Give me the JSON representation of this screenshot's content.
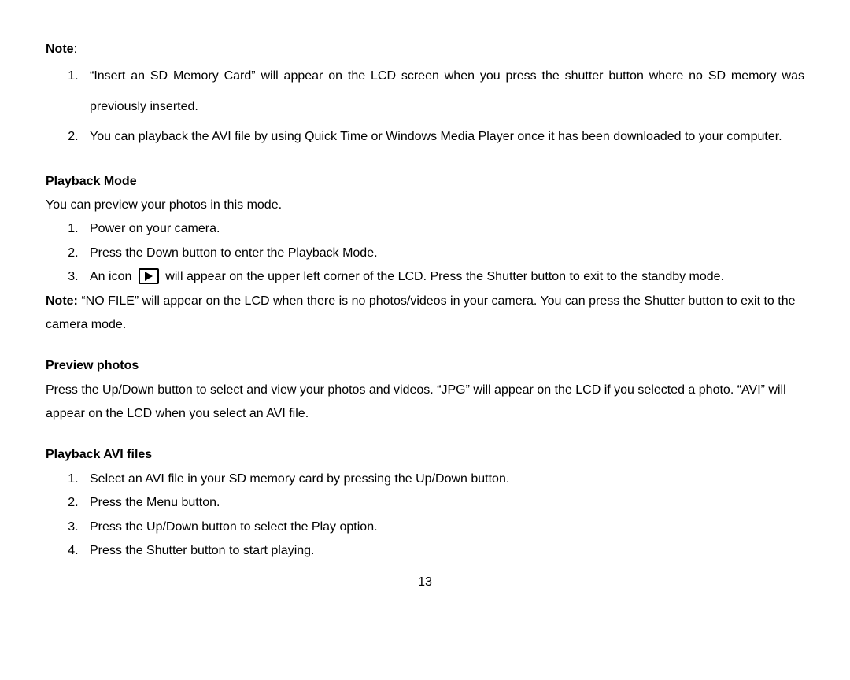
{
  "note_section": {
    "label": "Note",
    "items": [
      "“Insert an SD Memory Card” will appear on the LCD screen when you press the shutter button where no SD memory was previously inserted.",
      "You can playback the AVI file by using Quick Time or Windows Media Player once it has been downloaded to your computer."
    ]
  },
  "playback_mode": {
    "heading": "Playback Mode",
    "intro": "You can preview your photos in this mode.",
    "steps": {
      "s1": "Power on your camera.",
      "s2": "Press the Down button to enter the Playback Mode.",
      "s3_pre": "An icon",
      "s3_post": "will appear on the upper left corner of the LCD. Press the Shutter button to exit to the standby mode."
    },
    "note_label": "Note:",
    "note_body": "“NO FILE” will appear on the LCD when there is no photos/videos in your camera. You can press the Shutter button to exit to the camera mode."
  },
  "preview_photos": {
    "heading": "Preview photos",
    "body": "Press the Up/Down button to select and view your photos and videos. “JPG” will appear on the LCD if you selected a photo. “AVI” will appear on the LCD when you select an AVI file."
  },
  "playback_avi": {
    "heading": "Playback AVI files",
    "steps": [
      "Select an AVI file in your SD memory card by pressing the Up/Down button.",
      "Press the Menu button.",
      "Press the Up/Down button to select the Play option.",
      "Press the Shutter button to start playing."
    ]
  },
  "page_number": "13"
}
